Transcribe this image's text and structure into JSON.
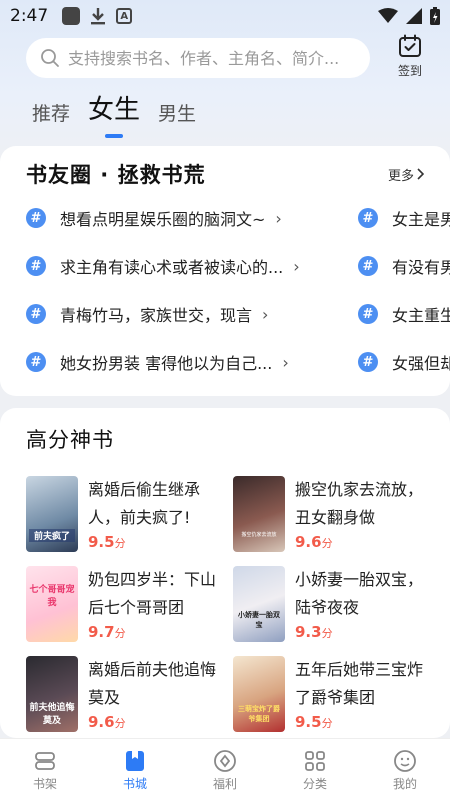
{
  "status": {
    "time": "2:47"
  },
  "search": {
    "placeholder": "支持搜索书名、作者、主角名、简介..."
  },
  "checkin": {
    "label": "签到"
  },
  "tabs": [
    {
      "label": "推荐"
    },
    {
      "label": "女生"
    },
    {
      "label": "男生"
    }
  ],
  "book_circle": {
    "title": "书友圈 · 拯救书荒",
    "more_label": "更多",
    "topics_left": [
      "想看点明星娱乐圈的脑洞文~",
      "求主角有读心术或者被读心的...",
      "青梅竹马，家族世交，现言",
      "她女扮男装 害得他以为自己..."
    ],
    "topics_right": [
      "女主是男",
      "有没有男",
      "女主重生",
      "女强但却"
    ]
  },
  "top_books": {
    "title": "高分神书",
    "score_unit": "分",
    "items": [
      {
        "title": "离婚后偷生继承人，前夫疯了!",
        "score": "9.5",
        "cover_text": "前夫疯了"
      },
      {
        "title": "搬空仇家去流放，丑女翻身做",
        "score": "9.6",
        "cover_text": "搬空仇家去流放"
      },
      {
        "title": "奶包四岁半：下山后七个哥哥团",
        "score": "9.7",
        "cover_text": "七个哥哥宠我"
      },
      {
        "title": "小娇妻一胎双宝，陆爷夜夜",
        "score": "9.3",
        "cover_text": "小娇妻一胎双宝"
      },
      {
        "title": "离婚后前夫他追悔莫及",
        "score": "9.6",
        "cover_text": "前夫他追悔莫及"
      },
      {
        "title": "五年后她带三宝炸了爵爷集团",
        "score": "9.5",
        "cover_text": "三萌宝炸了爵爷集团"
      }
    ]
  },
  "bottom_nav": [
    {
      "label": "书架",
      "icon": "bookshelf-icon"
    },
    {
      "label": "书城",
      "icon": "bookstore-icon"
    },
    {
      "label": "福利",
      "icon": "welfare-icon"
    },
    {
      "label": "分类",
      "icon": "category-icon"
    },
    {
      "label": "我的",
      "icon": "profile-icon"
    }
  ],
  "colors": {
    "accent": "#2d7bf5",
    "score": "#f25b4a",
    "hash": "#4d8ff2"
  }
}
